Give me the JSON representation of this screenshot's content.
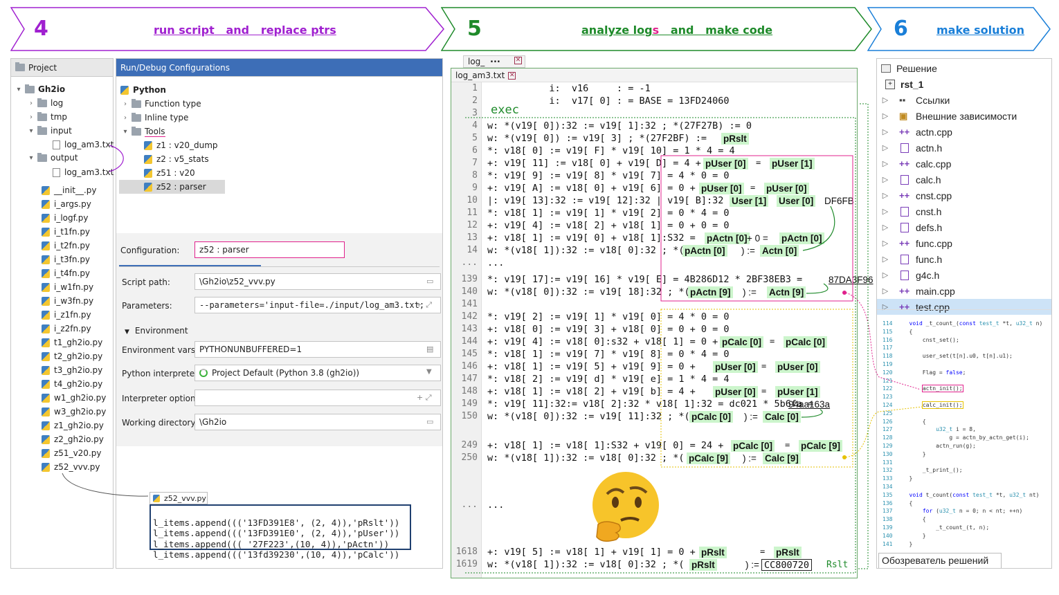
{
  "steps": [
    {
      "num": "4",
      "title_parts": [
        "run script",
        "and",
        "replace ptrs"
      ],
      "color": "#a020d0"
    },
    {
      "num": "5",
      "title_parts": [
        "analyze log",
        "s",
        "and",
        "make code"
      ],
      "color": "#1e8a2a"
    },
    {
      "num": "6",
      "title_parts": [
        "make solution"
      ],
      "color": "#1a7fd8"
    }
  ],
  "project": {
    "header": "Project",
    "root": "Gh2io",
    "folders": [
      "log",
      "tmp",
      "input",
      "output"
    ],
    "input_file": "log_am3.txt",
    "output_file": "log_am3.txt",
    "files": [
      "__init__.py",
      "i_args.py",
      "i_logf.py",
      "i_t1fn.py",
      "i_t2fn.py",
      "i_t3fn.py",
      "i_t4fn.py",
      "i_w1fn.py",
      "i_w3fn.py",
      "i_z1fn.py",
      "i_z2fn.py",
      "t1_gh2io.py",
      "t2_gh2io.py",
      "t3_gh2io.py",
      "t4_gh2io.py",
      "w1_gh2io.py",
      "w3_gh2io.py",
      "z1_gh2io.py",
      "z2_gh2io.py",
      "z51_v20.py",
      "z52_vvv.py"
    ]
  },
  "rundebug": {
    "header": "Run/Debug Configurations",
    "python": "Python",
    "items": [
      "Function type",
      "Inline type",
      "Tools"
    ],
    "tools": [
      "z1 : v20_dump",
      "z2 : v5_stats",
      "z51 : v20",
      "z52 : parser"
    ],
    "config_label": "Configuration:",
    "config_value": "z52 : parser",
    "fields": [
      {
        "label": "Script path:",
        "value": "\\Gh2io\\z52_vvv.py"
      },
      {
        "label": "Parameters:",
        "value": "--parameters='input-file=./input/log_am3.txt;"
      },
      {
        "label": "Environment vars:",
        "value": "PYTHONUNBUFFERED=1"
      },
      {
        "label": "Python interpreter:",
        "value": "Project Default (Python 3.8 (gh2io))"
      },
      {
        "label": "Interpreter options:",
        "value": ""
      },
      {
        "label": "Working directory:",
        "value": "\\Gh2io"
      }
    ],
    "environment": "Environment"
  },
  "snippet": {
    "tab": "z52_vvv.py",
    "lines": [
      "l_items.append((('13FD391E8', (2, 4)),'pRslt'))",
      "l_items.append((('13FD391E0', (2, 4)),'pUser'))",
      "l_items.append((( '27F223',(10, 4)),'pActn'))",
      "l_items.append((('13fd39230',(10, 4)),'pCalc'))"
    ]
  },
  "log": {
    "tab_back": "log_",
    "tab_back_dots": "...",
    "tab_front": "log_am3.txt",
    "exec": "exec",
    "lines": [
      {
        "n": "1",
        "c": "           i:  v16     : = -1"
      },
      {
        "n": "2",
        "c": "           i:  v17[ 0] : = BASE = 13FD24060"
      },
      {
        "n": "3",
        "c": ""
      },
      {
        "n": "4",
        "c": "w: *(v19[ 0]):32 := v19[ 1]:32 ; *(27F27B) := 0"
      },
      {
        "n": "5",
        "c": "w: *(v19[ 0]) := v19[ 3] ; *(27F2BF) :="
      },
      {
        "n": "6",
        "c": "*: v18[ 0] := v19[ F] * v19[ 10] = 1 * 4 = 4"
      },
      {
        "n": "7",
        "c": "+: v19[ 11] := v18[ 0] + v19[ D] = 4 +"
      },
      {
        "n": "8",
        "c": "*: v19[ 9] := v19[ 8] * v19[ 7] = 4 * 0 = 0"
      },
      {
        "n": "9",
        "c": "+: v19[ A] := v18[ 0] + v19[ 6] = 0 +"
      },
      {
        "n": "10",
        "c": "|: v19[ 13]:32 := v19[ 12]:32 | v19[ B]:32 ="
      },
      {
        "n": "11",
        "c": "*: v18[ 1] := v19[ 1] * v19[ 2] = 0 * 4 = 0"
      },
      {
        "n": "12",
        "c": "+: v19[ 4] := v18[ 2] + v18[ 1] = 0 + 0 = 0"
      },
      {
        "n": "13",
        "c": "+: v18[ 1] := v19[ 0] + v18[ 1]:S32 ="
      },
      {
        "n": "14",
        "c": "w: *(v18[ 1]):32 := v18[ 0]:32 ; *("
      },
      {
        "n": "...",
        "c": "..."
      },
      {
        "n": "139",
        "c": "*: v19[ 17]:= v19[ 16] * v19[ E] = 4B286D12 * 2BF38EB3 ="
      },
      {
        "n": "140",
        "c": "w: *(v18[ 0]):32 := v19[ 18]:32 ; *("
      },
      {
        "n": "141",
        "c": ""
      },
      {
        "n": "142",
        "c": "*: v19[ 2] := v19[ 1] * v19[ 0] = 4 * 0 = 0"
      },
      {
        "n": "143",
        "c": "+: v18[ 0] := v19[ 3] + v18[ 0] = 0 + 0 = 0"
      },
      {
        "n": "144",
        "c": "+: v19[ 4] := v18[ 0]:s32 + v18[ 1] = 0 +"
      },
      {
        "n": "145",
        "c": "*: v18[ 1] := v19[ 7] * v19[ 8] = 0 * 4 = 0"
      },
      {
        "n": "146",
        "c": "+: v18[ 1] := v19[ 5] + v19[ 9] = 0 +"
      },
      {
        "n": "147",
        "c": "*: v18[ 2] := v19[ d] * v19[ e] = 1 * 4 = 4"
      },
      {
        "n": "148",
        "c": "+: v18[ 1] := v18[ 2] + v19[ b] = 4 +"
      },
      {
        "n": "149",
        "c": "*: v19[ 11]:32:= v18[ 2]:32 * v18[ 1]:32 = dc021 * 5b6fa ="
      },
      {
        "n": "150",
        "c": "w: *(v18[ 0]):32 := v19[ 11]:32 ; *("
      },
      {
        "n": "249",
        "c": "+: v18[ 1] := v18[ 1]:S32 + v19[ 0] = 24 +"
      },
      {
        "n": "250",
        "c": "w: *(v18[ 1]):32 := v18[ 0]:32 ; *("
      },
      {
        "n": "...",
        "c": "..."
      },
      {
        "n": "1618",
        "c": "+: v19[ 5] := v18[ 1] + v19[ 1] = 0 +"
      },
      {
        "n": "1619",
        "c": "w: *(v18[ 1]):32 := v18[ 0]:32 ; *("
      }
    ],
    "hl": {
      "l5": "pRslt",
      "l7a": "pUser [0]",
      "l7b": "pUser [1]",
      "l9a": "pUser [0]",
      "l9b": "pUser [0]",
      "l10a": "User [1]",
      "l10b": "User [0]",
      "l10c": "DF6FB",
      "l13a": "pActn [0]",
      "l13b": "+ 0 =",
      "l13c": "pActn [0]",
      "l14a": "pActn [0]",
      "l14b": ") :=",
      "l14c": "Actn [0]",
      "l139": "87DA3F96",
      "l140a": "pActn [9]",
      "l140b": ") :=",
      "l140c": "Actn [9]",
      "l144a": "pCalc [0]",
      "l144b": "pCalc [0]",
      "l146a": "pUser [0]",
      "l146b": "pUser [0]",
      "l148a": "pUser [0]",
      "l148b": "pUser [1]",
      "l149": "94aa163a",
      "l150a": "pCalc [0]",
      "l150b": ") :=",
      "l150c": "Calc [0]",
      "l249a": "pCalc [0]",
      "l249b": "pCalc [9]",
      "l250a": "pCalc [9]",
      "l250b": ") :=",
      "l250c": "Calc [9]",
      "l1618a": "pRslt",
      "l1618b": "pRslt",
      "l1619a": "pRslt",
      "l1619b": ") :=",
      "l1619c": "CC800720",
      "rslt": "Rslt",
      "eq": "="
    }
  },
  "solution": {
    "title": "Решение",
    "project": "rst_1",
    "items": [
      "Ссылки",
      "Внешние зависимости",
      "actn.cpp",
      "actn.h",
      "calc.cpp",
      "calc.h",
      "cnst.cpp",
      "cnst.h",
      "defs.h",
      "func.cpp",
      "func.h",
      "g4c.h",
      "main.cpp",
      "test.cpp"
    ],
    "footer": "Обозреватель решений"
  },
  "colors": {
    "purple": "#a020d0",
    "green": "#1e8a2a",
    "blue": "#1a7fd8",
    "pink": "#e0208c",
    "gold": "#e6c200"
  }
}
